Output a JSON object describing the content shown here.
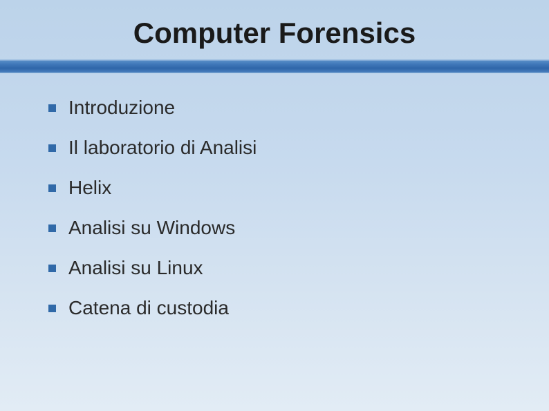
{
  "title": "Computer Forensics",
  "items": [
    {
      "label": "Introduzione"
    },
    {
      "label": "Il laboratorio di Analisi"
    },
    {
      "label": "Helix"
    },
    {
      "label": "Analisi su Windows"
    },
    {
      "label": "Analisi su Linux"
    },
    {
      "label": "Catena di custodia"
    }
  ]
}
